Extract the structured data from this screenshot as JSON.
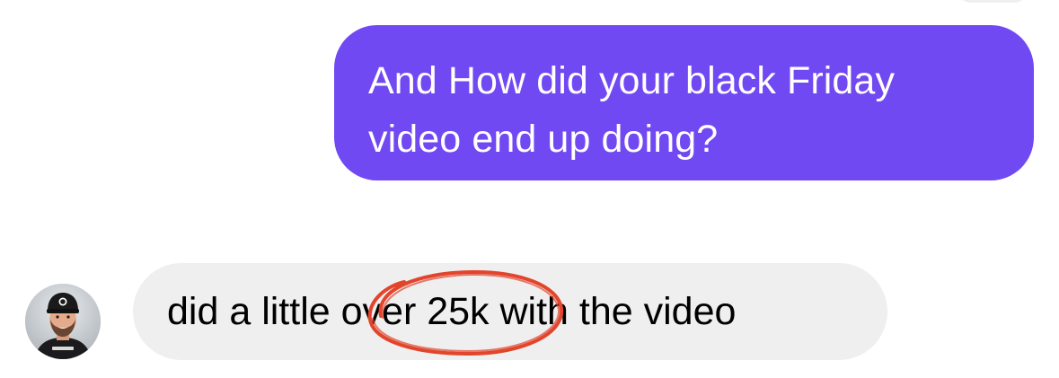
{
  "conversation": {
    "sent_message": {
      "line1": "And How did your black Friday",
      "line2": "video end up doing?"
    },
    "received_message": {
      "text_before": "did a little ",
      "text_highlight": "over 25k",
      "text_after": " with the video"
    }
  },
  "colors": {
    "sent_bubble": "#7149f3",
    "received_bubble": "#efefef",
    "annotation_circle": "#e2452c"
  },
  "icons": {
    "avatar": "profile-photo-man-with-cap"
  }
}
